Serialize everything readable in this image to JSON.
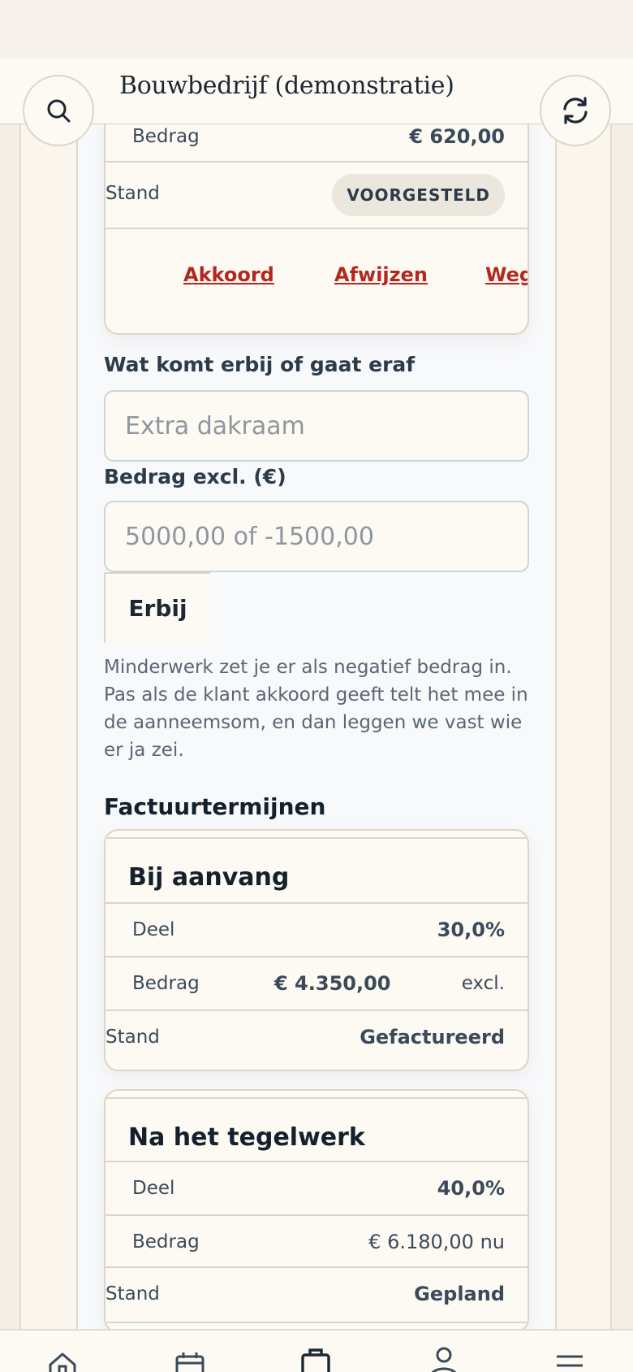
{
  "header": {
    "title": "Bouwbedrijf (demonstratie)",
    "search_icon": "search-icon",
    "refresh_icon": "refresh-icon"
  },
  "change_card": {
    "amount_label": "Bedrag",
    "amount_value": "€ 620,00",
    "status_label": "Stand",
    "status_badge": "VOORGESTELD",
    "actions": [
      "Akkoord",
      "Afwijzen",
      "Weg"
    ]
  },
  "form": {
    "description_label": "Wat komt erbij of gaat eraf",
    "description_placeholder": "Extra dakraam",
    "amount_label": "Bedrag excl. (€)",
    "amount_placeholder": "5000,00 of -1500,00",
    "add_button": "Erbij",
    "hint": "Minderwerk zet je er als negatief bedrag in. Pas als de klant akkoord geeft telt het mee in de aanneemsom, en dan leggen we vast wie er ja zei."
  },
  "terms": {
    "section_title": "Factuurtermijnen",
    "items": [
      {
        "title": "Bij aanvang",
        "share_label": "Deel",
        "share_value": "30,0%",
        "amount_label": "Bedrag",
        "amount_value": "€ 4.350,00",
        "amount_suffix": "excl.",
        "status_label": "Stand",
        "status_value": "Gefactureerd"
      },
      {
        "title": "Na het tegelwerk",
        "share_label": "Deel",
        "share_value": "40,0%",
        "amount_label": "Bedrag",
        "amount_value": "€ 6.180,00 nu",
        "status_label": "Stand",
        "status_value": "Gepland"
      }
    ]
  },
  "bottom_nav": {
    "icons": [
      "home-icon",
      "calendar-icon",
      "briefcase-icon",
      "person-icon",
      "menu-icon"
    ]
  },
  "colors": {
    "accent_link": "#b2281f",
    "background": "#f3efe6",
    "card": "#fdfaf3"
  }
}
